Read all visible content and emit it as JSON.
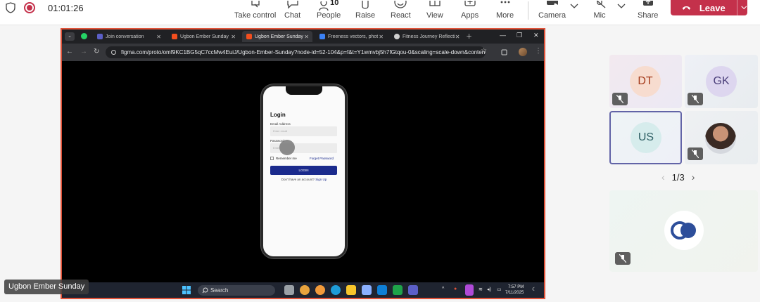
{
  "meeting": {
    "timer": "01:01:26",
    "recording_color": "#c4314b",
    "tools": [
      {
        "label": "Take control",
        "icon": "take-control-icon"
      },
      {
        "label": "Chat",
        "icon": "chat-icon"
      },
      {
        "label": "People",
        "icon": "people-icon",
        "count": "10"
      },
      {
        "label": "Raise",
        "icon": "raise-hand-icon"
      },
      {
        "label": "React",
        "icon": "react-icon"
      },
      {
        "label": "View",
        "icon": "view-icon"
      },
      {
        "label": "Apps",
        "icon": "apps-icon"
      },
      {
        "label": "More",
        "icon": "more-icon"
      },
      {
        "label": "Camera",
        "icon": "camera-icon"
      },
      {
        "label": "Mic",
        "icon": "mic-icon"
      },
      {
        "label": "Share",
        "icon": "share-icon"
      }
    ],
    "leave_label": "Leave",
    "leave_color": "#c4314b"
  },
  "shared_screen": {
    "presenter_name": "Ugbon Ember Sunday",
    "browser": {
      "tabs": [
        {
          "title": "Join conversation",
          "active": false
        },
        {
          "title": "Ugbon Ember Sunday",
          "active": false
        },
        {
          "title": "Ugbon Ember Sunday",
          "active": true
        },
        {
          "title": "Freeness vectors, phot",
          "active": false
        },
        {
          "title": "Fitness Journey Reflecti",
          "active": false
        }
      ],
      "url": "figma.com/proto/omf9KC1BG5qC7ccMw4EuiJ/Ugbon-Ember-Sunday?node-id=52-104&p=f&t=Y1wmvbj5h7fGtqou-0&scaling=scale-down&content-..."
    },
    "login": {
      "title": "Login",
      "email_label": "Email Address",
      "email_placeholder": "Enter email",
      "password_label": "Password",
      "password_placeholder": "Enter",
      "remember_label": "Remember me",
      "forgot_label": "Forget Password",
      "button_label": "LOGIN",
      "no_account_text": "Don't have an account?",
      "signup_label": "Sign Up"
    },
    "taskbar": {
      "search_label": "Search",
      "time": "7:57 PM",
      "date": "7/11/2025"
    }
  },
  "participants": [
    {
      "initials": "DT",
      "avatar_bg": "#f7dccf",
      "avatar_fg": "#a43a1a",
      "muted": true
    },
    {
      "initials": "GK",
      "avatar_bg": "#ddd6ef",
      "avatar_fg": "#4b3f7a",
      "muted": true
    },
    {
      "initials": "US",
      "avatar_bg": "#d6ecec",
      "avatar_fg": "#2c5e63",
      "muted": false,
      "active_speaker": true
    },
    {
      "initials": "",
      "photo": true,
      "muted": true
    },
    {
      "initials": "",
      "logo": true,
      "muted": true
    }
  ],
  "pager": {
    "text": "1/3"
  }
}
